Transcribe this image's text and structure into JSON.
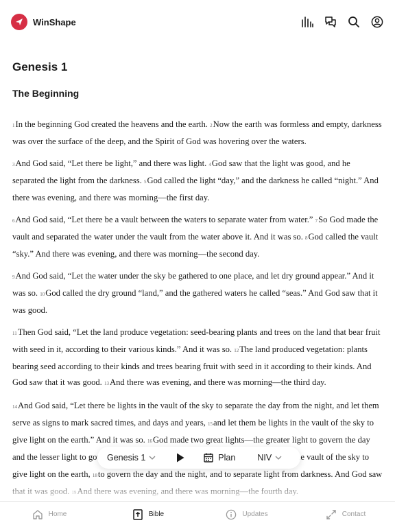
{
  "app": {
    "name": "WinShape"
  },
  "colors": {
    "brand": "#d62f45",
    "text": "#1a1a1a",
    "muted": "#9a9a9a"
  },
  "icons": {
    "header": [
      "audio-icon",
      "compare-icon",
      "search-icon",
      "account-icon"
    ]
  },
  "reader": {
    "chapter_title": "Genesis 1",
    "section_heading": "The Beginning",
    "paragraphs": [
      [
        {
          "n": "1",
          "t": "In the beginning God created the heavens and the earth."
        },
        {
          "n": "2",
          "t": "Now the earth was formless and empty, darkness was over the surface of the deep, and the Spirit of God was hovering over the waters."
        }
      ],
      [
        {
          "n": "3",
          "t": "And God said, “Let there be light,” and there was light."
        },
        {
          "n": "4",
          "t": "God saw that the light was good, and he separated the light from the darkness."
        },
        {
          "n": "5",
          "t": "God called the light “day,” and the darkness he called “night.” And there was evening, and there was morning—the first day."
        }
      ],
      [
        {
          "n": "6",
          "t": "And God said, “Let there be a vault between the waters to separate water from water.”"
        },
        {
          "n": "7",
          "t": "So God made the vault and separated the water under the vault from the water above it. And it was so."
        },
        {
          "n": "8",
          "t": "God called the vault “sky.” And there was evening, and there was morning—the second day."
        }
      ],
      [
        {
          "n": "9",
          "t": "And God said, “Let the water under the sky be gathered to one place, and let dry ground appear.” And it was so."
        },
        {
          "n": "10",
          "t": "God called the dry ground “land,” and the gathered waters he called “seas.” And God saw that it was good."
        }
      ],
      [
        {
          "n": "11",
          "t": "Then God said, “Let the land produce vegetation: seed-bearing plants and trees on the land that bear fruit with seed in it, according to their various kinds.” And it was so."
        },
        {
          "n": "12",
          "t": "The land produced vegetation: plants bearing seed according to their kinds and trees bearing fruit with seed in it according to their kinds. And God saw that it was good."
        },
        {
          "n": "13",
          "t": "And there was evening, and there was morning—the third day."
        }
      ],
      [
        {
          "n": "14",
          "t": "And God said, “Let there be lights in the vault of the sky to separate the day from the night, and let them serve as signs to mark sacred times, and days and years,"
        },
        {
          "n": "15",
          "t": "and let them be lights in the vault of the sky to give light on the earth.” And it was so."
        },
        {
          "n": "16",
          "t": "God made two great lights—the greater light to govern the day and the lesser light to govern the night. He also made the stars."
        },
        {
          "n": "17",
          "t": "God set them in the vault of the sky to give light on the earth,"
        },
        {
          "n": "18",
          "t": "to govern the day and the night, and to separate light from darkness. And God saw that it was good."
        },
        {
          "n": "19",
          "t": "And there was evening, and there was morning—the fourth day."
        }
      ]
    ]
  },
  "controls": {
    "chapter_select": "Genesis 1",
    "plan_label": "Plan",
    "version_select": "NIV"
  },
  "tabs": [
    {
      "label": "Home",
      "icon": "home-icon"
    },
    {
      "label": "Bible",
      "icon": "bible-icon",
      "active": true
    },
    {
      "label": "Updates",
      "icon": "info-icon"
    },
    {
      "label": "Contact",
      "icon": "contact-icon"
    }
  ]
}
